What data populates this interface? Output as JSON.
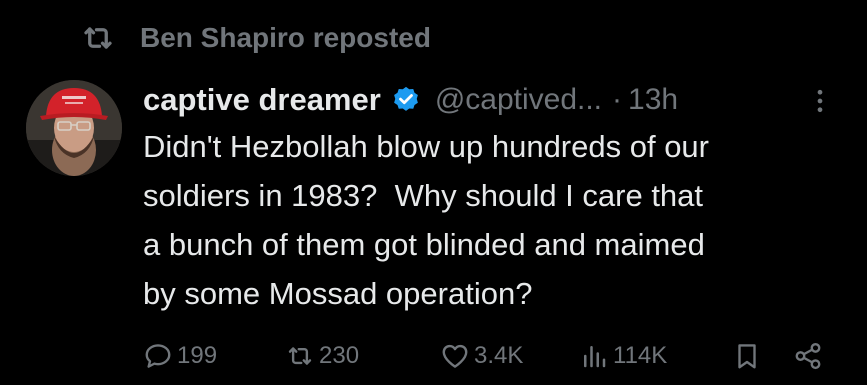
{
  "repost": {
    "icon": "repost-icon",
    "label": "Ben Shapiro reposted"
  },
  "tweet": {
    "author": {
      "display_name": "captive dreamer",
      "handle": "@captived...",
      "verified": true,
      "verified_color": "#1d9bf0",
      "avatar_icon": "avatar-red-cap"
    },
    "separator": "·",
    "time": "13h",
    "text": "Didn't Hezbollah blow up hundreds of our\nsoldiers in 1983?  Why should I care that\na bunch of them got blinded and maimed\nby some Mossad operation?",
    "actions": {
      "replies": "199",
      "reposts": "230",
      "likes": "3.4K",
      "views": "114K"
    }
  },
  "colors": {
    "background": "#000000",
    "text_primary": "#e7e9ea",
    "text_secondary": "#71767b",
    "accent": "#1d9bf0"
  }
}
